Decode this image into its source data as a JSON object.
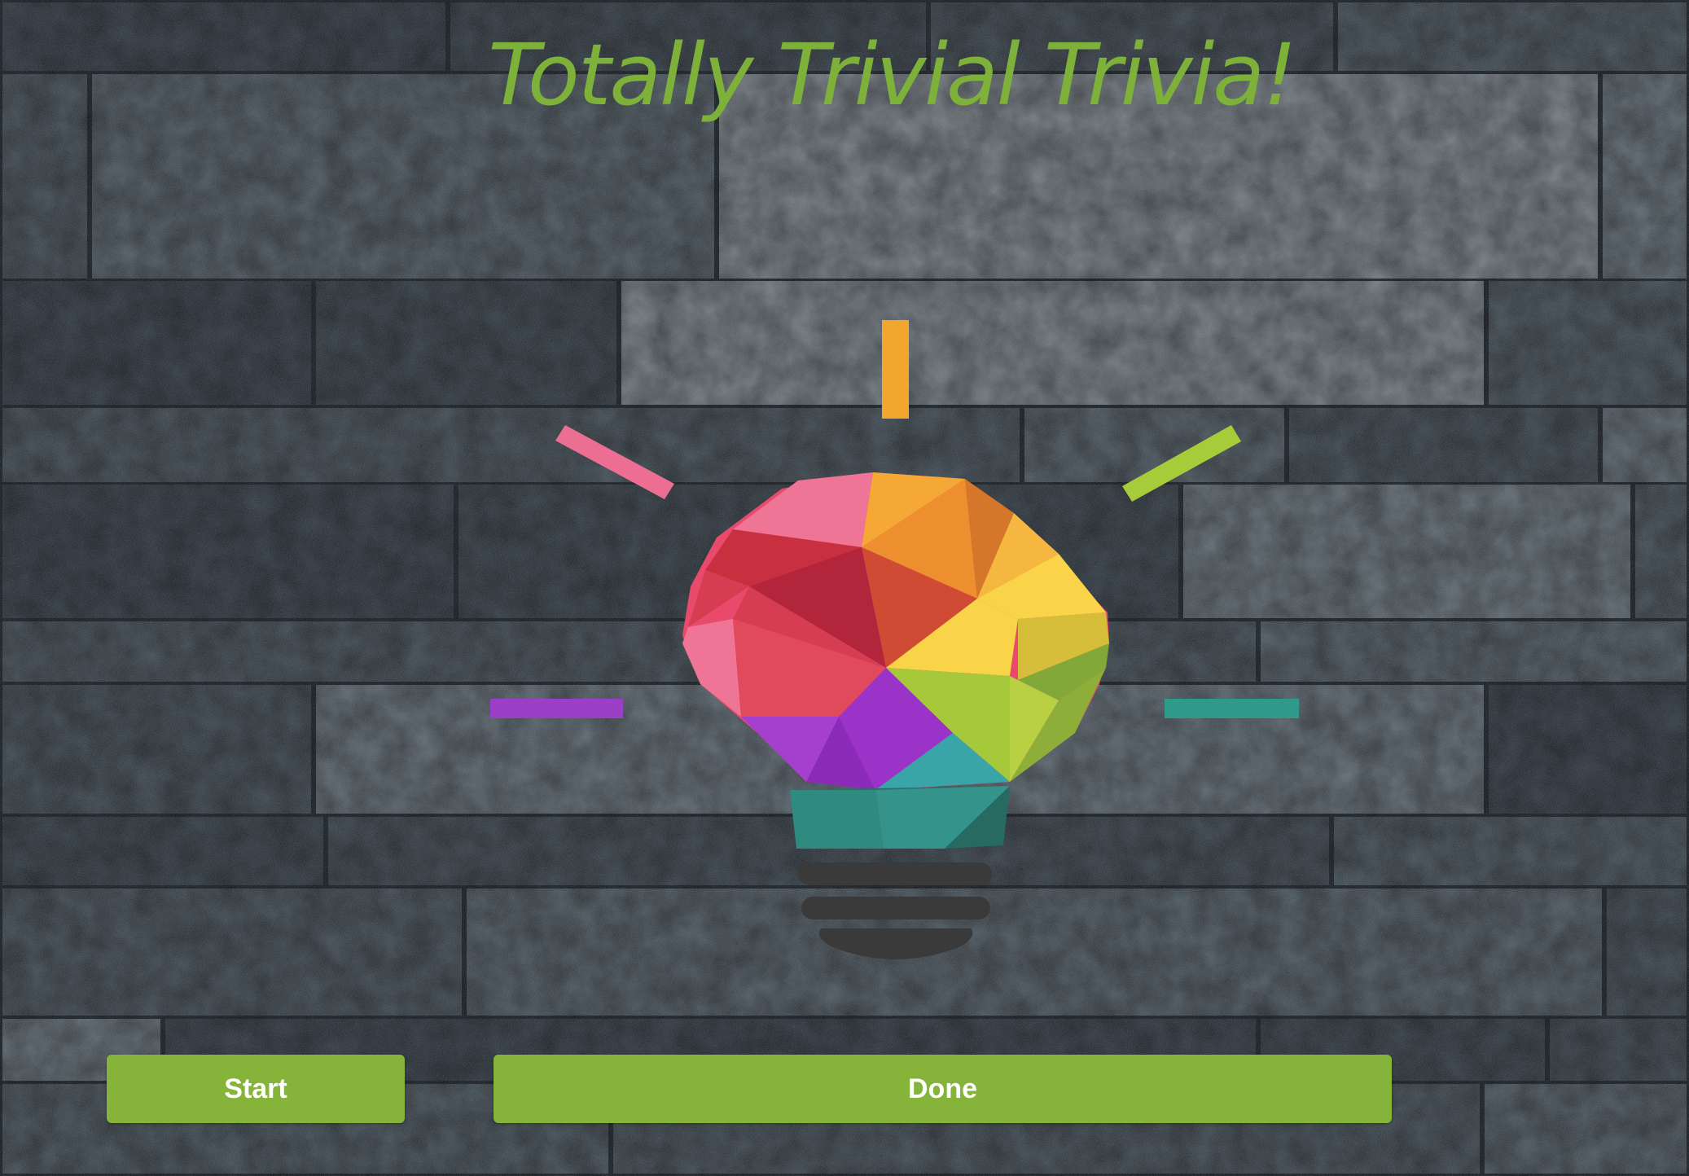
{
  "title": "Totally Trivial Trivia!",
  "buttons": {
    "start_label": "Start",
    "done_label": "Done"
  },
  "background": {
    "image": "dark slate stone brick wall",
    "base_color": "#2a3138"
  },
  "logo": {
    "icon": "lightbulb-icon",
    "ray_colors": [
      "#f1a72e",
      "#ec6f93",
      "#a6cc3a",
      "#9b3fc6",
      "#2f9a8a"
    ]
  },
  "colors": {
    "accent": "#86b43a",
    "title": "#7db13a",
    "button_text": "#ffffff"
  }
}
